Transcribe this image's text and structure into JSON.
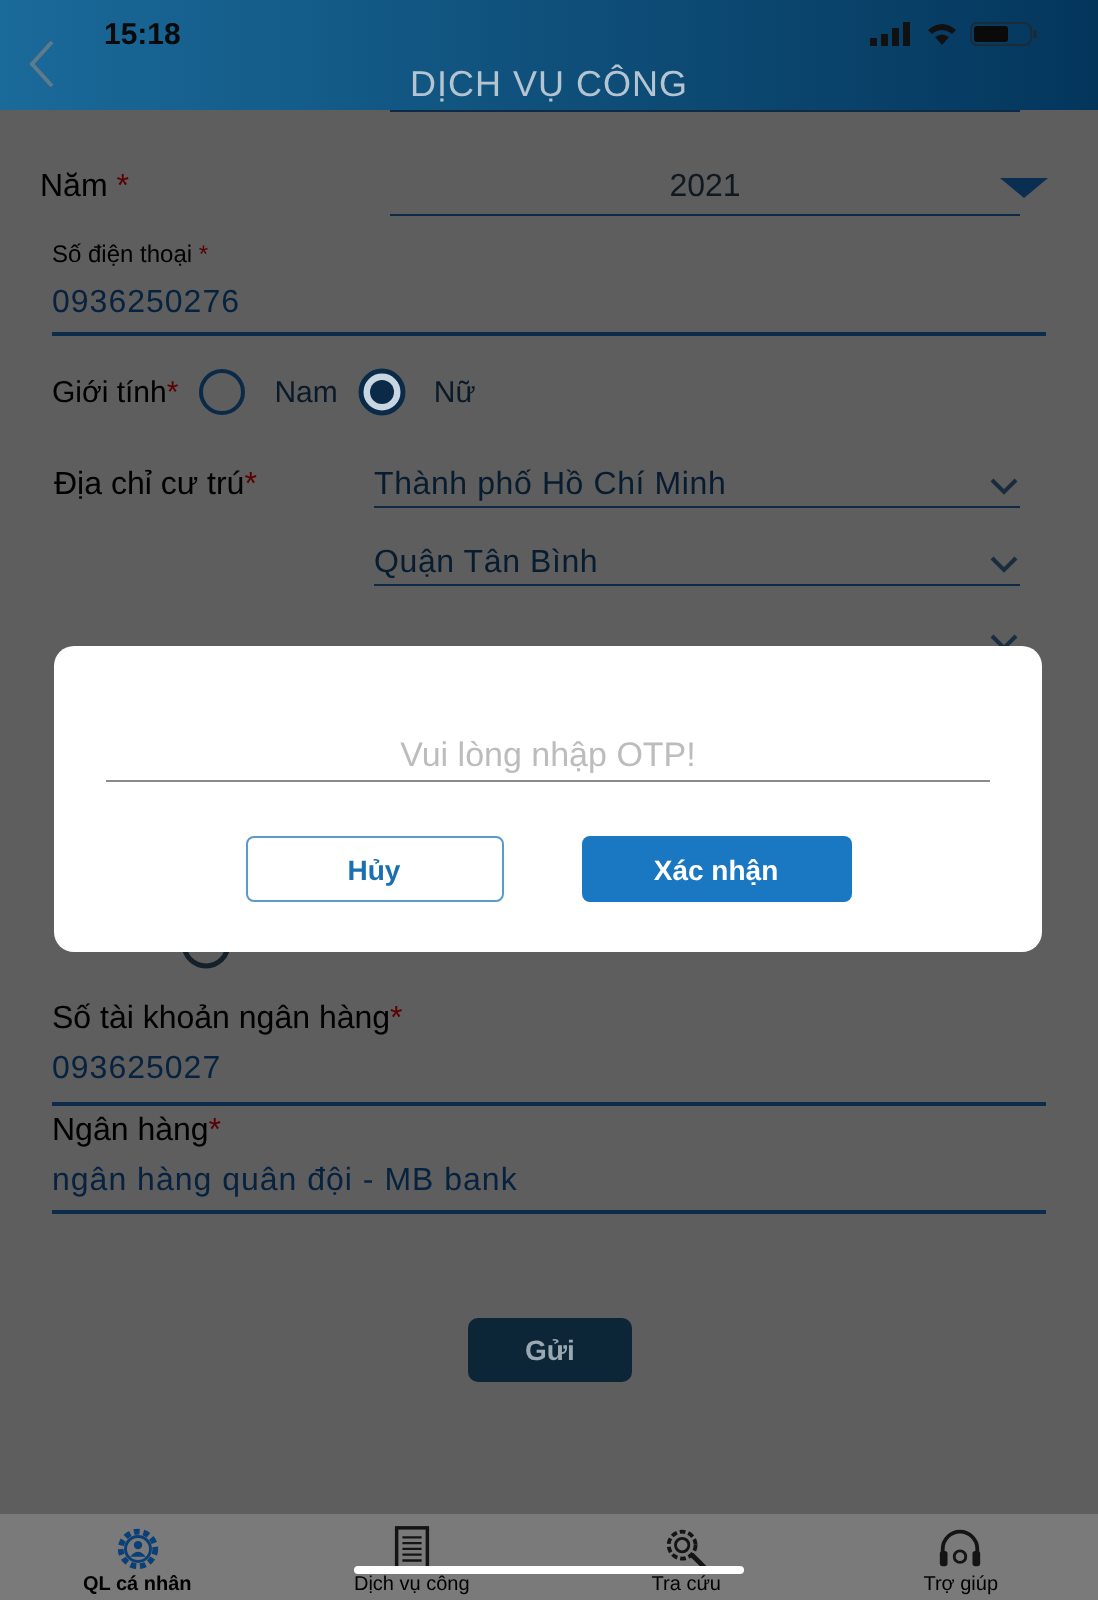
{
  "status_bar": {
    "time": "15:18"
  },
  "header": {
    "title": "DỊCH VỤ CÔNG"
  },
  "form": {
    "year": {
      "label": "Năm",
      "mark": "*",
      "value": "2021"
    },
    "phone": {
      "label": "Số điện thoại",
      "mark": "*",
      "value": "0936250276"
    },
    "gender": {
      "label": "Giới tính",
      "mark": "*",
      "options": [
        {
          "label": "Nam",
          "selected": false
        },
        {
          "label": "Nữ",
          "selected": true
        }
      ]
    },
    "address": {
      "label": "Địa chỉ cư trú",
      "mark": "*",
      "selects": [
        "Thành phố Hồ Chí Minh",
        "Quận Tân Bình"
      ]
    },
    "bank_account": {
      "label": "Số tài khoản ngân hàng",
      "mark": "*",
      "value": "093625027"
    },
    "bank": {
      "label": "Ngân hàng",
      "mark": "*",
      "value": "ngân hàng quân đội - MB bank"
    },
    "submit": "Gửi"
  },
  "dialog": {
    "placeholder": "Vui lòng nhập OTP!",
    "buttons": [
      {
        "label": "Hủy",
        "kind": "outline"
      },
      {
        "label": "Xác nhận",
        "kind": "primary"
      }
    ]
  },
  "tab_bar": [
    {
      "label": "QL cá nhân",
      "kind": "profile",
      "selected": true
    },
    {
      "label": "Dịch vụ công",
      "kind": "document",
      "selected": false
    },
    {
      "label": "Tra cứu",
      "kind": "search",
      "selected": false
    },
    {
      "label": "Trợ giúp",
      "kind": "headset",
      "selected": false
    }
  ]
}
